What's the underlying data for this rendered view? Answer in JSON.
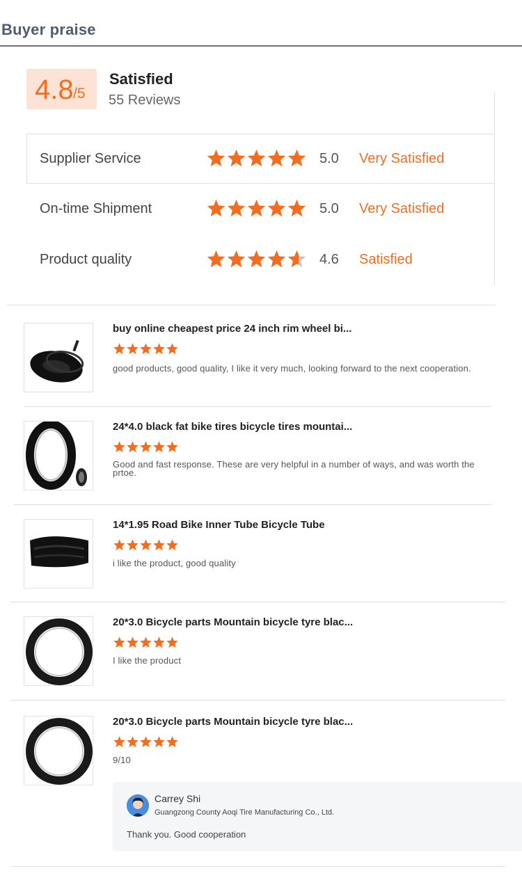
{
  "header": {
    "title": "Buyer praise"
  },
  "summary": {
    "score": "4.8",
    "denominator": "/5",
    "label": "Satisfied",
    "count": "55 Reviews"
  },
  "ratings": [
    {
      "label": "Supplier Service",
      "stars": 5,
      "score": "5.0",
      "word": "Very Satisfied"
    },
    {
      "label": "On-time Shipment",
      "stars": 5,
      "score": "5.0",
      "word": "Very Satisfied"
    },
    {
      "label": "Product quality",
      "stars": 4.6,
      "score": "4.6",
      "word": "Satisfied"
    }
  ],
  "reviews": [
    {
      "title": "buy online cheapest price 24 inch rim wheel bi...",
      "stars": 5,
      "text": "good products, good quality, I like it very much, looking forward to the next cooperation.",
      "thumb_icon": "inner-tube-with-valve-icon"
    },
    {
      "title": "24*4.0 black fat bike tires bicycle tires mountai...",
      "stars": 5,
      "text": "Good and fast response. These are very helpful in a number of ways, and was worth the prtoe.",
      "thumb_icon": "fat-tire-icon"
    },
    {
      "title": "14*1.95 Road Bike Inner Tube Bicycle Tube",
      "stars": 5,
      "text": "i like the product, good quality",
      "thumb_icon": "inner-tube-icon"
    },
    {
      "title": "20*3.0 Bicycle parts Mountain bicycle tyre blac...",
      "stars": 5,
      "text": "I like the product",
      "thumb_icon": "tyre-icon"
    },
    {
      "title": "20*3.0 Bicycle parts Mountain bicycle tyre blac...",
      "stars": 5,
      "text": "9/10",
      "thumb_icon": "tyre-icon"
    }
  ],
  "reply": {
    "name": "Carrey Shi",
    "company": "Guangzong County Aoqi Tire Manufacturing Co., Ltd.",
    "text": "Thank you. Good cooperation"
  },
  "colors": {
    "accent": "#f36d21",
    "star_empty": "#c8c8c8",
    "score_bg": "#fde3d5",
    "header_text": "#4d5f6e"
  }
}
